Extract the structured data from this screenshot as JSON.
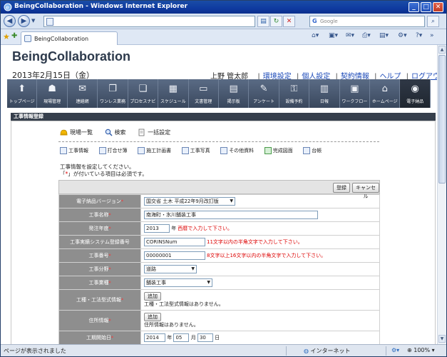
{
  "window": {
    "title": "BeingCollaboration - Windows Internet Explorer",
    "min": "_",
    "max": "□",
    "close": "✕"
  },
  "browser": {
    "address": "",
    "search_placeholder": "Google",
    "tab_label": "BeingCollaboration",
    "status_text": "ページが表示されました",
    "zone_text": "インターネット",
    "zoom_text": "100%"
  },
  "app": {
    "name": "BeingCollaboration",
    "date": "2013年2月15日（金）",
    "user": "上野 管太郎",
    "links": [
      "環境設定",
      "個人設定",
      "契約情報",
      "ヘルプ",
      "ログアウト"
    ]
  },
  "nav": [
    {
      "label": "トップページ",
      "icon": "up-arrow-icon",
      "glyph": "⬆"
    },
    {
      "label": "現場管理",
      "icon": "helmet-icon",
      "glyph": "☗"
    },
    {
      "label": "連絡網",
      "icon": "mail-icon",
      "glyph": "✉"
    },
    {
      "label": "ワンレス業務",
      "icon": "pages-icon",
      "glyph": "❐"
    },
    {
      "label": "プロセスナビ",
      "icon": "clipboard-icon",
      "glyph": "❏"
    },
    {
      "label": "スケジュール",
      "icon": "calendar-icon",
      "glyph": "▦"
    },
    {
      "label": "文書管理",
      "icon": "folder-icon",
      "glyph": "▭"
    },
    {
      "label": "掲示板",
      "icon": "board-icon",
      "glyph": "▤"
    },
    {
      "label": "アンケート",
      "icon": "pencil-icon",
      "glyph": "✎"
    },
    {
      "label": "設備予約",
      "icon": "key-icon",
      "glyph": "⚿"
    },
    {
      "label": "日報",
      "icon": "report-icon",
      "glyph": "▥"
    },
    {
      "label": "ワークフロー",
      "icon": "workflow-icon",
      "glyph": "▣"
    },
    {
      "label": "ホームページ",
      "icon": "home-icon",
      "glyph": "⌂"
    },
    {
      "label": "電子納品",
      "icon": "cd-folder-icon",
      "glyph": "◉",
      "active": true
    }
  ],
  "section_title": "工事情報登録",
  "top_links": [
    "現場一覧",
    "検索",
    "一括設定"
  ],
  "sub_links": [
    "工事情報",
    "打合せ簿",
    "施工計画書",
    "工事写真",
    "その他資料",
    "完成図面",
    "台帳"
  ],
  "instructions": {
    "line1": "工事情報を設定してください。",
    "line2_a": "「",
    "line2_star": "*",
    "line2_b": "」が付いている項目は必須です。"
  },
  "buttons": {
    "register": "登録",
    "cancel": "キャンセル",
    "add": "追加"
  },
  "form": {
    "version_label": "電子納品バージョン",
    "version_value": "国交省 土木 平成22年9月改訂版",
    "name_label": "工事名称",
    "name_value": "南海町・氷川舗装工事",
    "year_label": "発注年度",
    "year_value": "2013",
    "year_unit": "年",
    "year_note": "西暦で入力して下さい。",
    "corins_label": "工事実績システム登録番号",
    "corins_value": "CORINSNum",
    "corins_note": "11文字以内の半角文字で入力して下さい。",
    "number_label": "工事番号",
    "number_value": "00000001",
    "number_note": "8文字以上16文字以内の半角文字で入力して下さい。",
    "field_label": "工事分野",
    "field_value": "道路",
    "type_label": "工事業種",
    "type_value": "舗装工事",
    "method_label": "工種・工法型式情報",
    "method_note": "工種・工法型式情報はありません。",
    "address_label": "住所情報",
    "address_note": "住所情報はありません。",
    "start_label": "工期開始日",
    "start_year": "2014",
    "start_month": "05",
    "start_day": "30",
    "u_year": "年",
    "u_month": "月",
    "u_day": "日"
  }
}
